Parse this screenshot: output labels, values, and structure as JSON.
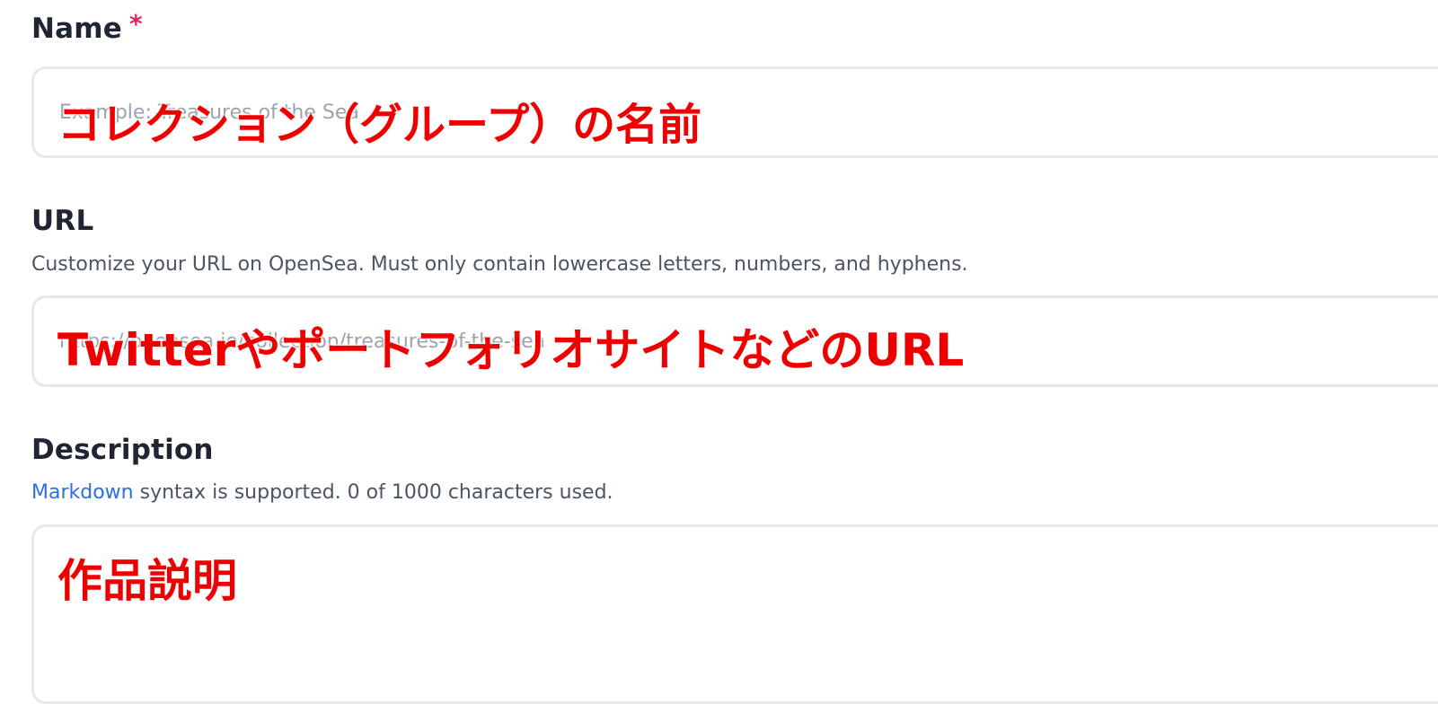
{
  "name_field": {
    "label": "Name",
    "required_marker": "*",
    "placeholder": "Example: Treasures of the Sea",
    "annotation": "コレクション（グループ）の名前"
  },
  "url_field": {
    "label": "URL",
    "helper": "Customize your URL on OpenSea. Must only contain lowercase letters, numbers, and hyphens.",
    "placeholder": "https://opensea.io/collection/treasures-of-the-sea",
    "annotation": "TwitterやポートフォリオサイトなどのURL"
  },
  "description_field": {
    "label": "Description",
    "helper_link": "Markdown",
    "helper_rest": " syntax is supported. 0 of 1000 characters used.",
    "annotation": "作品説明"
  },
  "colors": {
    "annotation": "#ee0000",
    "link": "#2b6fe0",
    "required": "#e0245e"
  }
}
